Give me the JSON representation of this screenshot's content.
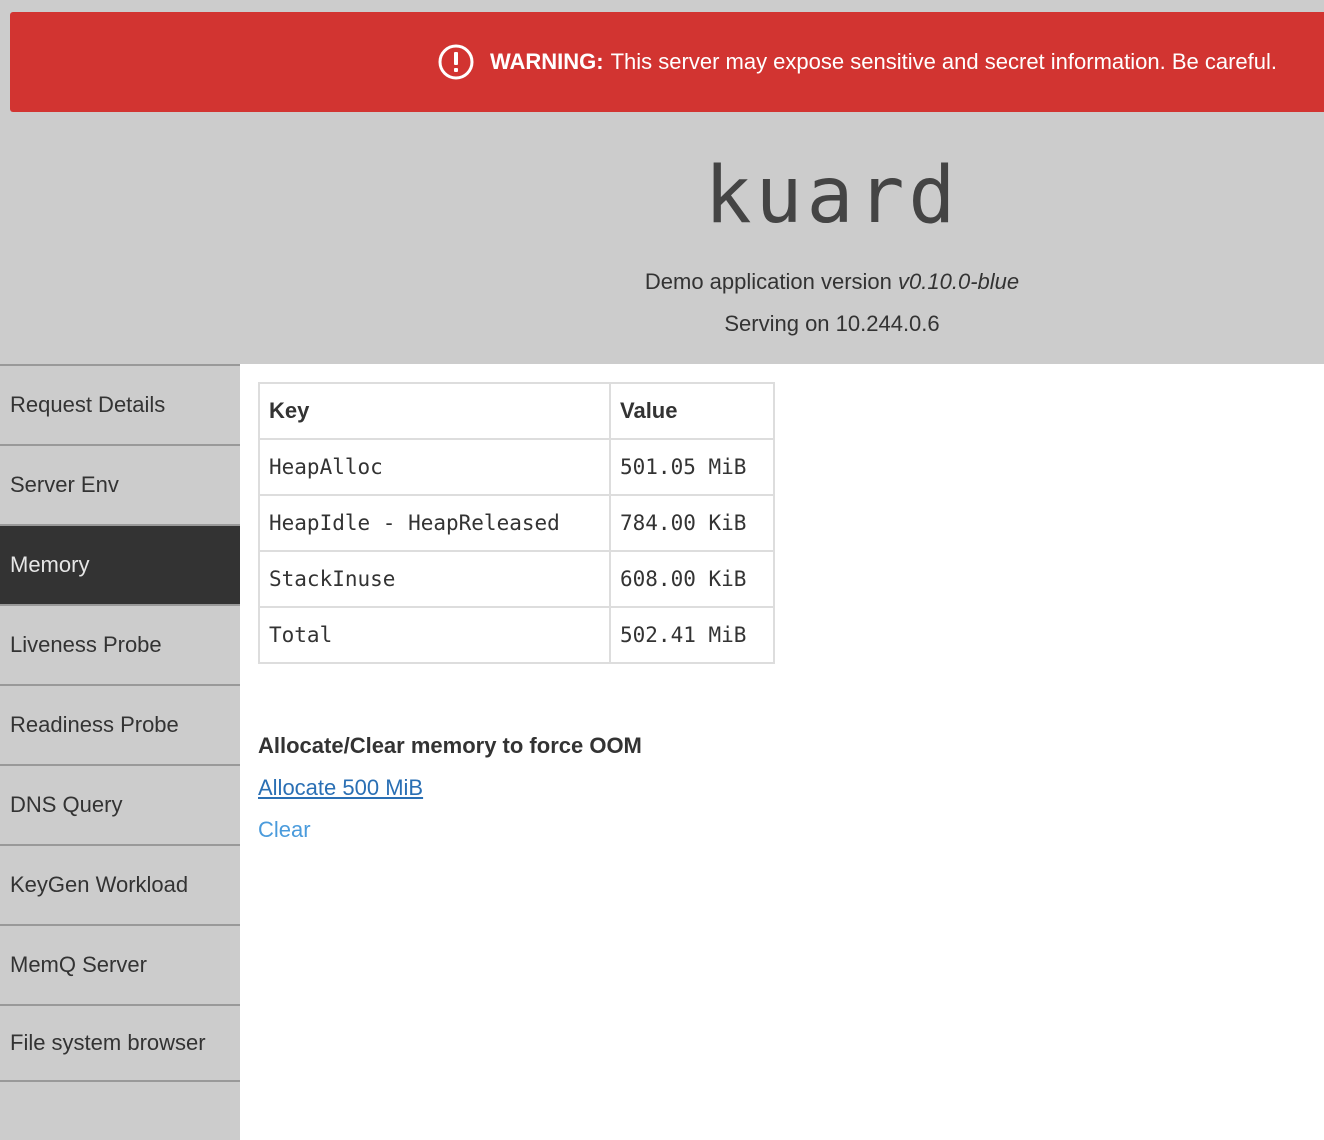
{
  "warning": {
    "icon": "alert-circle-icon",
    "label": "WARNING:",
    "message": "This server may expose sensitive and secret information. Be careful.",
    "color": "#d23431"
  },
  "header": {
    "title": "kuard",
    "version_prefix": "Demo application version",
    "version": "v0.10.0-blue",
    "serving": "Serving on 10.244.0.6"
  },
  "sidebar": {
    "items": [
      {
        "label": "Request Details",
        "active": false
      },
      {
        "label": "Server Env",
        "active": false
      },
      {
        "label": "Memory",
        "active": true
      },
      {
        "label": "Liveness Probe",
        "active": false
      },
      {
        "label": "Readiness Probe",
        "active": false
      },
      {
        "label": "DNS Query",
        "active": false
      },
      {
        "label": "KeyGen Workload",
        "active": false
      },
      {
        "label": "MemQ Server",
        "active": false
      },
      {
        "label": "File system browser",
        "active": false
      }
    ]
  },
  "memory_table": {
    "headers": [
      "Key",
      "Value"
    ],
    "rows": [
      [
        "HeapAlloc",
        "501.05 MiB"
      ],
      [
        "HeapIdle - HeapReleased",
        "784.00 KiB"
      ],
      [
        "StackInuse",
        "608.00 KiB"
      ],
      [
        "Total",
        "502.41 MiB"
      ]
    ]
  },
  "oom": {
    "heading": "Allocate/Clear memory to force OOM",
    "allocate_label": "Allocate 500 MiB",
    "clear_label": "Clear"
  }
}
